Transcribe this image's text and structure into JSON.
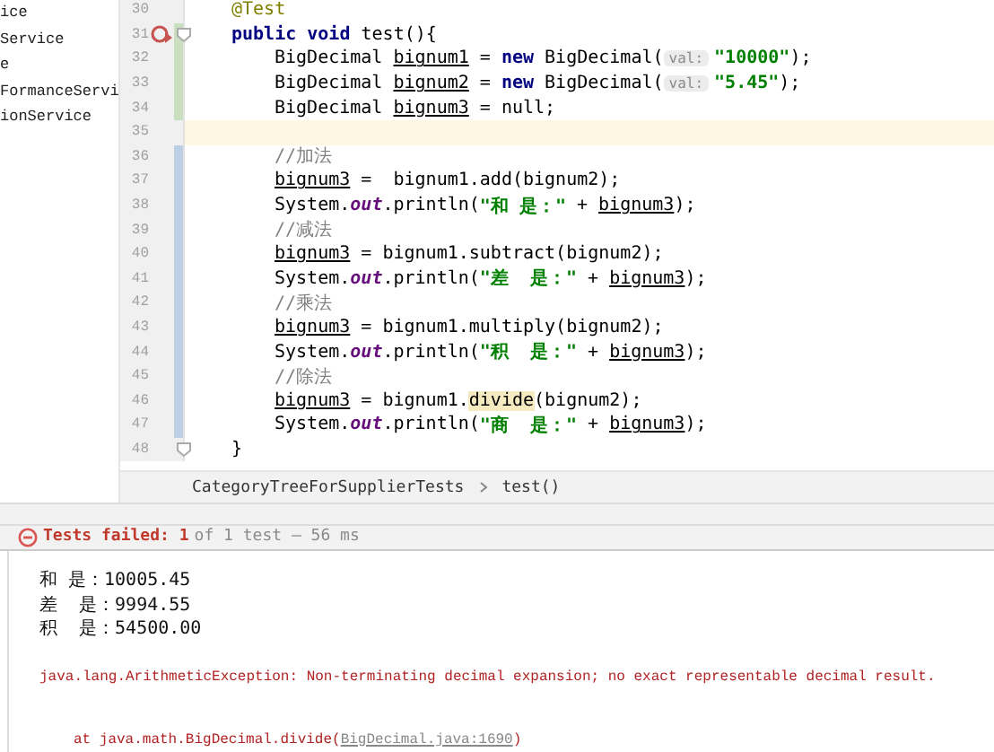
{
  "sidebar": {
    "items": [
      {
        "label": "ice"
      },
      {
        "label": "Service"
      },
      {
        "label": "e"
      },
      {
        "label": "FormanceServi"
      },
      {
        "label": "ionService"
      }
    ]
  },
  "editor": {
    "lines": [
      {
        "number": "30",
        "tokens": [
          {
            "kind": "annotation",
            "text": "@Test"
          }
        ]
      },
      {
        "number": "31",
        "failed_test": true,
        "fold": true,
        "added": true,
        "tokens": [
          {
            "kind": "keyword",
            "text": "public void"
          },
          {
            "kind": "plain",
            "text": " test(){"
          }
        ]
      },
      {
        "number": "32",
        "added": true,
        "in_body": true,
        "tokens": [
          {
            "kind": "plain",
            "text": "BigDecimal "
          },
          {
            "kind": "var",
            "text": "bignum1"
          },
          {
            "kind": "plain",
            "text": " = "
          },
          {
            "kind": "keyword",
            "text": "new"
          },
          {
            "kind": "plain",
            "text": " BigDecimal("
          },
          {
            "kind": "hint",
            "text": "val:"
          },
          {
            "kind": "string",
            "text": "\"10000\""
          },
          {
            "kind": "plain",
            "text": ");"
          }
        ]
      },
      {
        "number": "33",
        "added": true,
        "in_body": true,
        "tokens": [
          {
            "kind": "plain",
            "text": "BigDecimal "
          },
          {
            "kind": "var",
            "text": "bignum2"
          },
          {
            "kind": "plain",
            "text": " = "
          },
          {
            "kind": "keyword",
            "text": "new"
          },
          {
            "kind": "plain",
            "text": " BigDecimal("
          },
          {
            "kind": "hint",
            "text": "val:"
          },
          {
            "kind": "string",
            "text": "\"5.45\""
          },
          {
            "kind": "plain",
            "text": ");"
          }
        ]
      },
      {
        "number": "34",
        "added": true,
        "in_body": true,
        "tokens": [
          {
            "kind": "plain",
            "text": "BigDecimal "
          },
          {
            "kind": "var",
            "text": "bignum3"
          },
          {
            "kind": "plain",
            "text": " = null;"
          }
        ]
      },
      {
        "number": "35",
        "current": true
      },
      {
        "number": "36",
        "modified": true,
        "in_body": true,
        "tokens": [
          {
            "kind": "comment",
            "text": "//加法"
          }
        ]
      },
      {
        "number": "37",
        "modified": true,
        "in_body": true,
        "tokens": [
          {
            "kind": "var",
            "text": "bignum3"
          },
          {
            "kind": "plain",
            "text": " =  bignum1.add(bignum2);"
          }
        ]
      },
      {
        "number": "38",
        "modified": true,
        "in_body": true,
        "tokens": [
          {
            "kind": "plain",
            "text": "System."
          },
          {
            "kind": "field",
            "text": "out"
          },
          {
            "kind": "plain",
            "text": ".println("
          },
          {
            "kind": "string",
            "text": "\"和 是：\""
          },
          {
            "kind": "plain",
            "text": " + "
          },
          {
            "kind": "var",
            "text": "bignum3"
          },
          {
            "kind": "plain",
            "text": ");"
          }
        ]
      },
      {
        "number": "39",
        "modified": true,
        "in_body": true,
        "tokens": [
          {
            "kind": "comment",
            "text": "//减法"
          }
        ]
      },
      {
        "number": "40",
        "modified": true,
        "in_body": true,
        "tokens": [
          {
            "kind": "var",
            "text": "bignum3"
          },
          {
            "kind": "plain",
            "text": " = bignum1.subtract(bignum2);"
          }
        ]
      },
      {
        "number": "41",
        "modified": true,
        "in_body": true,
        "tokens": [
          {
            "kind": "plain",
            "text": "System."
          },
          {
            "kind": "field",
            "text": "out"
          },
          {
            "kind": "plain",
            "text": ".println("
          },
          {
            "kind": "string",
            "text": "\"差  是：\""
          },
          {
            "kind": "plain",
            "text": " + "
          },
          {
            "kind": "var",
            "text": "bignum3"
          },
          {
            "kind": "plain",
            "text": ");"
          }
        ]
      },
      {
        "number": "42",
        "modified": true,
        "in_body": true,
        "tokens": [
          {
            "kind": "comment",
            "text": "//乘法"
          }
        ]
      },
      {
        "number": "43",
        "modified": true,
        "in_body": true,
        "tokens": [
          {
            "kind": "var",
            "text": "bignum3"
          },
          {
            "kind": "plain",
            "text": " = bignum1.multiply(bignum2);"
          }
        ]
      },
      {
        "number": "44",
        "modified": true,
        "in_body": true,
        "tokens": [
          {
            "kind": "plain",
            "text": "System."
          },
          {
            "kind": "field",
            "text": "out"
          },
          {
            "kind": "plain",
            "text": ".println("
          },
          {
            "kind": "string",
            "text": "\"积  是：\""
          },
          {
            "kind": "plain",
            "text": " + "
          },
          {
            "kind": "var",
            "text": "bignum3"
          },
          {
            "kind": "plain",
            "text": ");"
          }
        ]
      },
      {
        "number": "45",
        "modified": true,
        "in_body": true,
        "tokens": [
          {
            "kind": "comment",
            "text": "//除法"
          }
        ]
      },
      {
        "number": "46",
        "modified": true,
        "in_body": true,
        "tokens": [
          {
            "kind": "var",
            "text": "bignum3"
          },
          {
            "kind": "plain",
            "text": " = bignum1."
          },
          {
            "kind": "highlight",
            "text": "divide"
          },
          {
            "kind": "plain",
            "text": "(bignum2);"
          }
        ]
      },
      {
        "number": "47",
        "modified": true,
        "in_body": true,
        "tokens": [
          {
            "kind": "plain",
            "text": "System."
          },
          {
            "kind": "field",
            "text": "out"
          },
          {
            "kind": "plain",
            "text": ".println("
          },
          {
            "kind": "string",
            "text": "\"商  是：\""
          },
          {
            "kind": "plain",
            "text": " + "
          },
          {
            "kind": "var",
            "text": "bignum3"
          },
          {
            "kind": "plain",
            "text": ");"
          }
        ]
      },
      {
        "number": "48",
        "fold": true,
        "tokens": [
          {
            "kind": "plain",
            "text": "}"
          }
        ]
      }
    ]
  },
  "breadcrumb": [
    "CategoryTreeForSupplierTests",
    "test()"
  ],
  "test_status": {
    "failed": true,
    "label": "Tests failed: 1",
    "detail": "of 1 test – 56 ms"
  },
  "console": {
    "lines": [
      {
        "kind": "output",
        "text": "和 是：10005.45"
      },
      {
        "kind": "output",
        "text": "差  是：9994.55"
      },
      {
        "kind": "output",
        "text": "积  是：54500.00"
      },
      {
        "kind": "blank"
      },
      {
        "kind": "error",
        "text": "java.lang.ArithmeticException: Non-terminating decimal expansion; no exact representable decimal result."
      },
      {
        "kind": "blank"
      },
      {
        "kind": "trace",
        "text": "at java.math.BigDecimal.divide(",
        "link": "BigDecimal.java:1690",
        "tail": ")"
      }
    ]
  }
}
